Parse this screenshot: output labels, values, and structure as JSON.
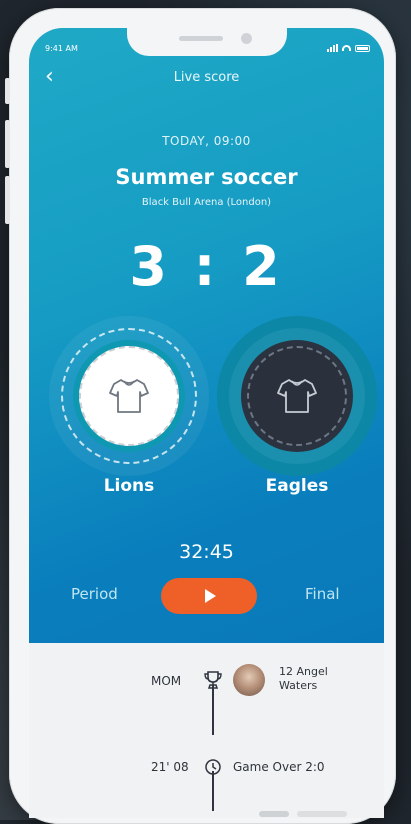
{
  "status": {
    "time": "9:41 AM"
  },
  "nav": {
    "title": "Live score",
    "back_icon": "chevron-left-icon"
  },
  "match": {
    "date": "TODAY, 09:00",
    "event": "Summer soccer",
    "venue": "Black Bull Arena (London)",
    "score": "3 : 2",
    "clock": "32:45"
  },
  "teams": [
    {
      "name": "Lions",
      "icon": "shirt-icon"
    },
    {
      "name": "Eagles",
      "icon": "shirt-icon"
    }
  ],
  "controls": {
    "period": "Period",
    "final": "Final",
    "play_icon": "play-icon"
  },
  "timeline": {
    "mom_label": "MOM",
    "mom_icon": "trophy-icon",
    "mom_player": "12 Angel Waters",
    "event_time": "21' 08",
    "event_icon": "clock-icon",
    "event_text": "Game Over 2:0"
  },
  "colors": {
    "hero_start": "#1fa9c6",
    "hero_end": "#0978b9",
    "accent": "#ef5f28",
    "dark_team": "#2a313c"
  }
}
